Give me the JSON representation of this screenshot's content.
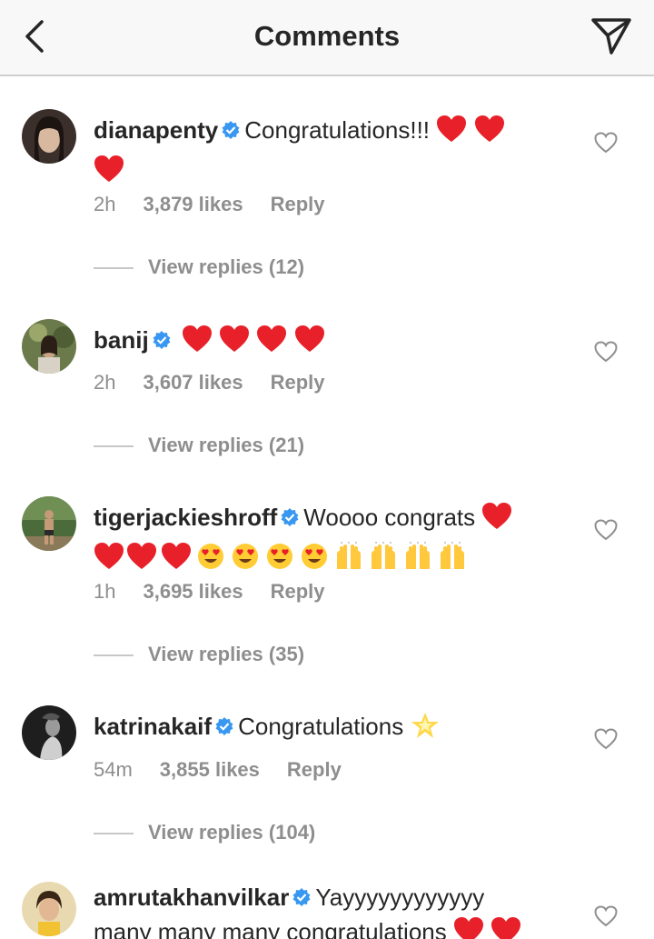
{
  "header": {
    "title": "Comments"
  },
  "comments": [
    {
      "username": "dianapenty",
      "text": "Congratulations!!!",
      "emojis_line1": [
        "heart",
        "heart"
      ],
      "emojis_line2": [
        "heart"
      ],
      "time": "2h",
      "likes": "3,879 likes",
      "reply": "Reply",
      "view_replies": "View replies (12)"
    },
    {
      "username": "banij",
      "text": "",
      "emojis_line1": [
        "heart",
        "heart",
        "heart",
        "heart"
      ],
      "time": "2h",
      "likes": "3,607 likes",
      "reply": "Reply",
      "view_replies": "View replies (21)"
    },
    {
      "username": "tigerjackieshroff",
      "text": "Woooo congrats",
      "emojis_line1": [
        "heart"
      ],
      "emojis_line2": [
        "heart",
        "heart",
        "heart",
        "heart-eyes",
        "heart-eyes",
        "heart-eyes",
        "heart-eyes",
        "raised-hands",
        "raised-hands",
        "raised-hands",
        "raised-hands"
      ],
      "time": "1h",
      "likes": "3,695 likes",
      "reply": "Reply",
      "view_replies": "View replies (35)"
    },
    {
      "username": "katrinakaif",
      "text": "Congratulations",
      "emojis_line1": [
        "glowing-star"
      ],
      "time": "54m",
      "likes": "3,855 likes",
      "reply": "Reply",
      "view_replies": "View replies (104)"
    },
    {
      "username": "amrutakhanvilkar",
      "text": "Yayyyyyyyyyyyy",
      "text_line2": "many many many congratulations",
      "emojis_line2": [
        "heart",
        "heart"
      ]
    }
  ],
  "colors": {
    "verified": "#3897f0",
    "heart": "#e8202a",
    "meta": "#8e8e8e",
    "header_bg": "#f8f8f8"
  }
}
